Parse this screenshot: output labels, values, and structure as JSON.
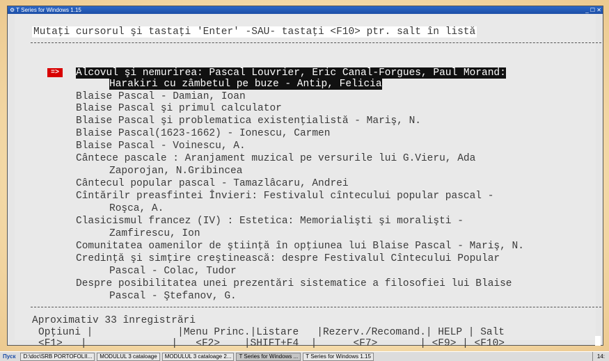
{
  "window": {
    "title": "T Series for Windows 1.15",
    "controls": "_ ☐ ✕"
  },
  "prompt": "Mutaţi cursorul şi tastaţi 'Enter' -SAU- tastaţi <F10> ptr. salt în listă",
  "selection_marker": "=>",
  "entries": [
    {
      "line1": "Alcovul şi nemurirea: Pascal Louvrier, Eric Canal-Forgues, Paul Morand:",
      "line2": "Harakiri cu zâmbetul pe buze - Antip, Felicia"
    },
    {
      "line1": "Blaise Pascal - Damian, Ioan"
    },
    {
      "line1": "Blaise Pascal şi primul calculator"
    },
    {
      "line1": "Blaise Pascal şi problematica existenţialistă - Mariş, N."
    },
    {
      "line1": "Blaise Pascal(1623-1662) - Ionescu, Carmen"
    },
    {
      "line1": "Blaise Pascal - Voinescu, A."
    },
    {
      "line1": "Cântece pascale : Aranjament muzical pe versurile lui G.Vieru, Ada",
      "line2": "Zaporojan, N.Gribincea"
    },
    {
      "line1": "Cântecul popular pascal - Tamazlâcaru, Andrei"
    },
    {
      "line1": "Cîntărilr preasfintei Învieri: Festivalul cîntecului popular pascal -",
      "line2": "Roşca, A."
    },
    {
      "line1": "Clasicismul francez (IV) : Estetica: Memorialişti şi moralişti -",
      "line2": "Zamfirescu, Ion"
    },
    {
      "line1": "Comunitatea oamenilor de ştiinţă în opţiunea lui Blaise Pascal - Mariş, N."
    },
    {
      "line1": "Credinţă şi simţire creştinească: despre Festivalul Cîntecului Popular",
      "line2": "Pascal - Colac, Tudor"
    },
    {
      "line1": "Despre posibilitatea unei prezentări sistematice a filosofiei lui Blaise",
      "line2": "Pascal - Ştefanov, G."
    }
  ],
  "status": "Aproximativ 33 înregistrări",
  "fkeys": {
    "row1": "Opţiuni |              |Menu Princ.|Listare   |Rezerv./Recomand.| HELP | Salt",
    "row2": "<F1>   |              |   <F2>    |SHIFT+F4  |      <F7>       | <F9> | <F10>"
  },
  "taskbar": {
    "start": "Пуск",
    "items": [
      "D:\\doc\\SRB PORTOFOLII...",
      "MODULUL 3 cataloage",
      "MODULUL 3 cataloage 2...",
      "T Series for Windows ...",
      "T Series for Windows 1.15"
    ],
    "clock": "14:"
  }
}
